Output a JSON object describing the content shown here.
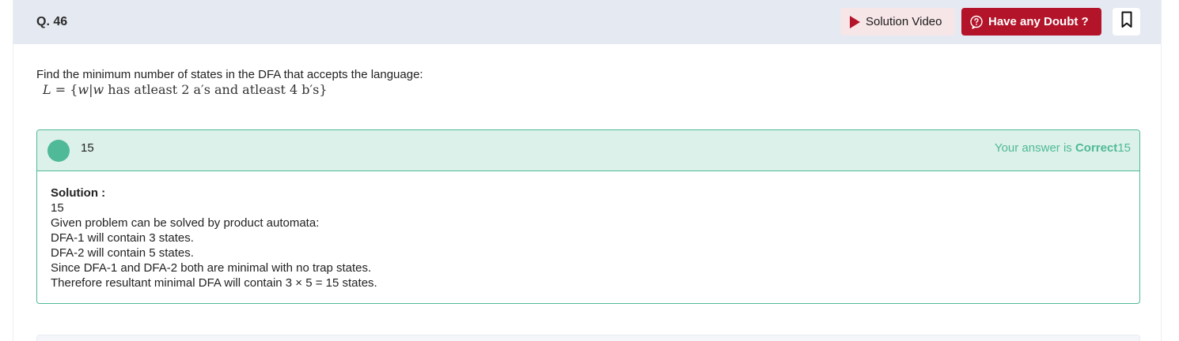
{
  "question": {
    "number": "Q. 46",
    "text": "Find the minimum number of states in the DFA that accepts the language:",
    "math": {
      "lhs": "L",
      "equals": "=",
      "set_open": "{",
      "var": "w",
      "bar": "|",
      "var2": "w",
      "condition": " has atleast 2 a′s and atleast 4 b′s",
      "set_close": "}"
    }
  },
  "header": {
    "solution_video_label": "Solution Video",
    "doubt_label": "Have any Doubt ?",
    "icons": {
      "play": "play-icon",
      "doubt": "question-bubble-icon",
      "bookmark": "bookmark-icon"
    },
    "colors": {
      "accent": "#b3142a",
      "header_bg": "#e5e9f2"
    }
  },
  "answer": {
    "value": "15",
    "result_prefix": "Your answer is ",
    "result_status": "Correct",
    "result_value": "15",
    "colors": {
      "correct": "#4fb998",
      "correct_bg": "#dcf1e9"
    }
  },
  "solution": {
    "title": "Solution :",
    "lines": [
      "15",
      "Given problem can be solved by product automata:",
      "DFA-1 will contain 3 states.",
      "DFA-2 will contain 5 states.",
      "Since DFA-1 and DFA-2 both are minimal with no trap states.",
      "Therefore resultant minimal DFA will contain 3 × 5 = 15 states."
    ]
  }
}
